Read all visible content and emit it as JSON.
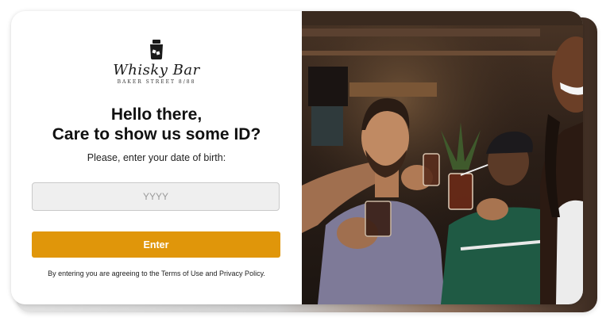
{
  "logo": {
    "name": "Whisky Bar",
    "subtitle": "BAKER STREET 8/88",
    "icon": "whisky-glass-icon"
  },
  "heading": {
    "line1": "Hello there,",
    "line2": "Care to show us some ID?"
  },
  "prompt": "Please, enter your date of birth:",
  "year_input": {
    "value": "",
    "placeholder": "YYYY"
  },
  "enter_button": {
    "label": "Enter",
    "color": "#e0960a"
  },
  "terms": "By entering you are agreeing to the Terms of Use and Privacy Policy.",
  "photo": {
    "subject": "friends-toasting-at-bar-image"
  }
}
